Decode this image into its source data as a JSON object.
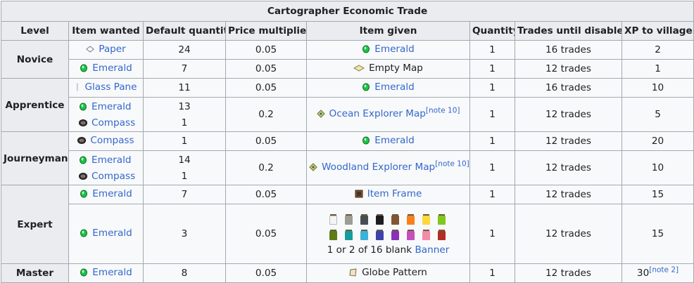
{
  "table": {
    "caption": "Cartographer Economic Trade",
    "headers": [
      "Level",
      "Item wanted",
      "Default quantity",
      "Price multiplier",
      "Item given",
      "Quantity",
      "Trades until disabled",
      "XP to villager"
    ],
    "levels": {
      "novice": "Novice",
      "apprentice": "Apprentice",
      "journeyman": "Journeyman",
      "expert": "Expert",
      "master": "Master"
    },
    "items": {
      "paper": "Paper",
      "emerald": "Emerald",
      "empty_map": "Empty Map",
      "glass_pane": "Glass Pane",
      "compass": "Compass",
      "ocean_map": "Ocean Explorer Map",
      "woodland_map": "Woodland Explorer Map",
      "item_frame": "Item Frame",
      "banner_text": "1 or 2 of 16 blank",
      "banner": "Banner",
      "globe": "Globe Pattern"
    },
    "notes": {
      "n10": "[note 10]",
      "n2": "[note 2]"
    },
    "rows": [
      {
        "qty": "24",
        "mult": "0.05",
        "given_qty": "1",
        "trades": "16 trades",
        "xp": "2"
      },
      {
        "qty": "7",
        "mult": "0.05",
        "given_qty": "1",
        "trades": "12 trades",
        "xp": "1"
      },
      {
        "qty": "11",
        "mult": "0.05",
        "given_qty": "1",
        "trades": "16 trades",
        "xp": "10"
      },
      {
        "qty_a": "13",
        "qty_b": "1",
        "mult": "0.2",
        "given_qty": "1",
        "trades": "12 trades",
        "xp": "5"
      },
      {
        "qty": "1",
        "mult": "0.05",
        "given_qty": "1",
        "trades": "12 trades",
        "xp": "20"
      },
      {
        "qty_a": "14",
        "qty_b": "1",
        "mult": "0.2",
        "given_qty": "1",
        "trades": "12 trades",
        "xp": "10"
      },
      {
        "qty": "7",
        "mult": "0.05",
        "given_qty": "1",
        "trades": "12 trades",
        "xp": "15"
      },
      {
        "qty": "3",
        "mult": "0.05",
        "given_qty": "1",
        "trades": "12 trades",
        "xp": "15"
      },
      {
        "qty": "8",
        "mult": "0.05",
        "given_qty": "1",
        "trades": "12 trades",
        "xp": "30"
      }
    ]
  },
  "colors": {
    "link": "#3366cc",
    "border": "#a2a9b1",
    "header_bg": "#eaecf0",
    "cell_bg": "#f8f9fa",
    "emerald": "#17c544",
    "banner_colors": [
      "#f4f4f4",
      "#9d9d97",
      "#474f52",
      "#1d1d21",
      "#835432",
      "#f9801d",
      "#fed83d",
      "#80c71f",
      "#5e7c16",
      "#169c9c",
      "#3ab3da",
      "#3c44aa",
      "#8932b8",
      "#c74ebd",
      "#f38baa",
      "#b02e26"
    ]
  }
}
